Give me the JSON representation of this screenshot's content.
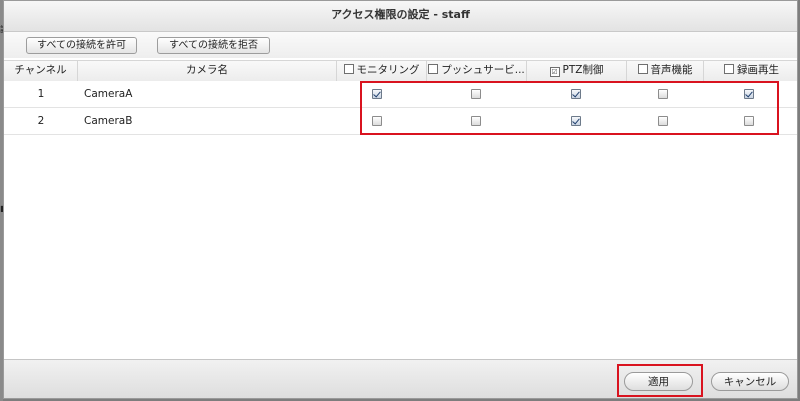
{
  "dialog": {
    "title": "アクセス権限の設定 - staff"
  },
  "toolbar": {
    "allow_all_label": "すべての接続を許可",
    "deny_all_label": "すべての接続を拒否"
  },
  "table": {
    "columns": {
      "channel": "チャンネル",
      "camera_name": "カメラ名",
      "monitoring": "モニタリング",
      "push_service": "プッシュサービ...",
      "ptz": "PTZ制御",
      "audio": "音声機能",
      "playback": "録画再生"
    },
    "header_checkbox_ptz_mark": "☑",
    "rows": [
      {
        "channel": "1",
        "camera_name": "CameraA",
        "monitoring": true,
        "push_service": false,
        "ptz": true,
        "audio": false,
        "playback": true
      },
      {
        "channel": "2",
        "camera_name": "CameraB",
        "monitoring": false,
        "push_service": false,
        "ptz": true,
        "audio": false,
        "playback": false
      }
    ]
  },
  "footer": {
    "apply_label": "適用",
    "cancel_label": "キャンセル"
  },
  "background": {
    "left_edge_chars": [
      "設",
      "■"
    ]
  },
  "colors": {
    "highlight": "#d9131f"
  }
}
